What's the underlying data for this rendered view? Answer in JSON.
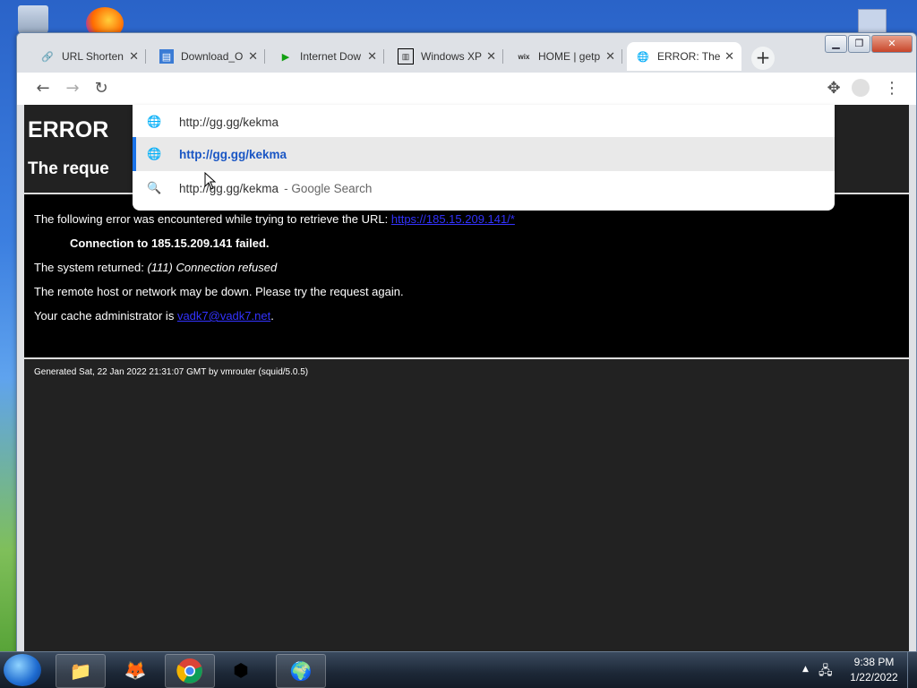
{
  "tabs": [
    {
      "title": "URL Shorten",
      "icon": "link-icon"
    },
    {
      "title": "Download_O",
      "icon": "chart-icon"
    },
    {
      "title": "Internet Dow",
      "icon": "play-icon"
    },
    {
      "title": "Windows XP",
      "icon": "archive-icon"
    },
    {
      "title": "HOME | getp",
      "icon": "wix-icon"
    },
    {
      "title": "ERROR: The",
      "icon": "globe-icon"
    }
  ],
  "omnibox": {
    "input_value": "http://gg.gg/kekma",
    "suggestion_url": "http://gg.gg/kekma",
    "suggestion_search": "http://gg.gg/kekma",
    "suggestion_search_suffix": "- Google Search"
  },
  "page": {
    "error_title": "ERROR",
    "error_subtitle": "The reque",
    "line1_text": "The following error was encountered while trying to retrieve the URL: ",
    "line1_link": "https://185.15.209.141/*",
    "line2_text": "Connection to 185.15.209.141 failed.",
    "line3_prefix": "The system returned: ",
    "line3_italic": "(111) Connection refused",
    "line4_text": "The remote host or network may be down. Please try the request again.",
    "line5_prefix": "Your cache administrator is ",
    "line5_link": "vadk7@vadk7.net",
    "line5_suffix": ".",
    "footer": "Generated Sat, 22 Jan 2022 21:31:07 GMT by vmrouter (squid/5.0.5)"
  },
  "taskbar": {
    "time": "9:38 PM",
    "date": "1/22/2022"
  }
}
